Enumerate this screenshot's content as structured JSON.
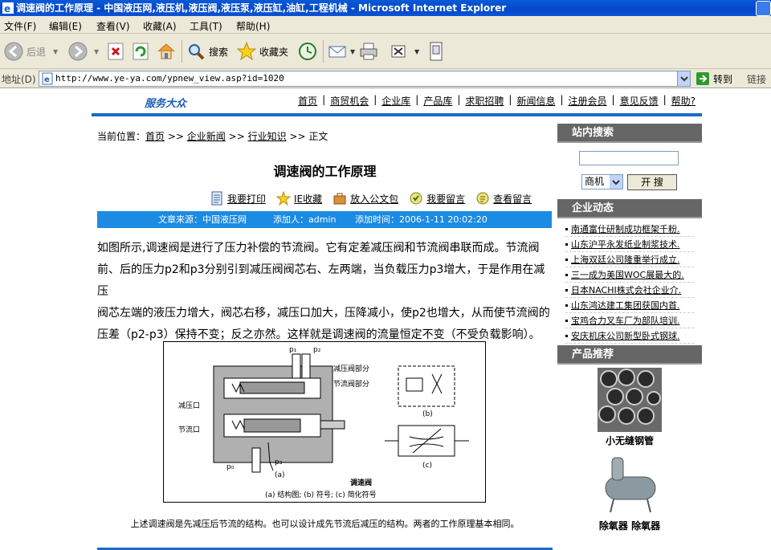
{
  "window": {
    "title": "调速阀的工作原理 - 中国液压网,液压机,液压阀,液压泵,液压缸,油缸,工程机械 - Microsoft Internet Explorer"
  },
  "menubar": {
    "items": [
      "文件(F)",
      "编辑(E)",
      "查看(V)",
      "收藏(A)",
      "工具(T)",
      "帮助(H)"
    ]
  },
  "toolbar": {
    "back_label": "后退",
    "search_label": "搜索",
    "favorites_label": "收藏夹"
  },
  "addressbar": {
    "label": "地址(D)",
    "url": "http://www.ye-ya.com/ypnew_view.asp?id=1020",
    "go_label": "转到",
    "links_label": "链接"
  },
  "site": {
    "brand": "服务大众",
    "nav": [
      "首页",
      "商贸机会",
      "企业库",
      "产品库",
      "求职招聘",
      "新闻信息",
      "注册会员",
      "意见反馈",
      "帮助?"
    ]
  },
  "breadcrumb": {
    "prefix": "当前位置：",
    "items": [
      "首页",
      "企业新闻",
      "行业知识"
    ],
    "separator": ">>",
    "current": "正文"
  },
  "article": {
    "title": "调速阀的工作原理",
    "actions": [
      "我要打印",
      "IE收藏",
      "放入公文包",
      "我要留言",
      "查看留言"
    ],
    "source": "文章来源：中国液压网",
    "author": "添加人：admin",
    "time": "添加时间：2006-1-11 20:02:20",
    "paragraphs": [
      "如图所示,调速阀是进行了压力补偿的节流阀。它有定差减压阀和节流阀串联而成。节流阀",
      "前、后的压力p2和p3分别引到减压阀阀芯右、左两端，当负载压力p3增大，于是作用在减压",
      "阀芯左端的液压力增大，阀芯右移，减压口加大，压降减小，使p2也增大，从而使节流阀的",
      "压差（p2-p3）保持不变；反之亦然。这样就是调速阀的流量恒定不变（不受负载影响）。"
    ],
    "caption": "上述调速阀是先减压后节流的结构。也可以设计成先节流后减压的结构。两者的工作原理基本相同。"
  },
  "figure": {
    "labels": {
      "p1": "p₁",
      "p2": "p₂",
      "p3": "p₃",
      "p0": "p₀",
      "reducing_section": "减压阀部分",
      "throttle_section": "节流阀部分",
      "reducing_port": "减压口",
      "throttle_port": "节流口",
      "a": "(a)",
      "b": "(b)",
      "c": "(c)",
      "name": "调速阀",
      "legend": "(a) 结构图; (b) 符号; (c) 简化符号"
    }
  },
  "sidebar": {
    "search_heading": "站内搜索",
    "search_select": "商机",
    "search_button": "开 搜",
    "news_heading": "企业动态",
    "news": [
      "南通富仕研制成功框架千粉.",
      "山东沪平永发纸业制浆技术.",
      "上海双廷公司隆重举行成立.",
      "三一成为美国WOC展最大的.",
      "日本NACHI株式会社企业介.",
      "山东鸿达建工集团获国内首.",
      "宝鸡合力叉车厂为部队培训.",
      "安庆机床公司新型卧式钢球."
    ],
    "products_heading": "产品推荐",
    "products": [
      "小无缝钢管",
      "除氧器 除氧器"
    ]
  }
}
